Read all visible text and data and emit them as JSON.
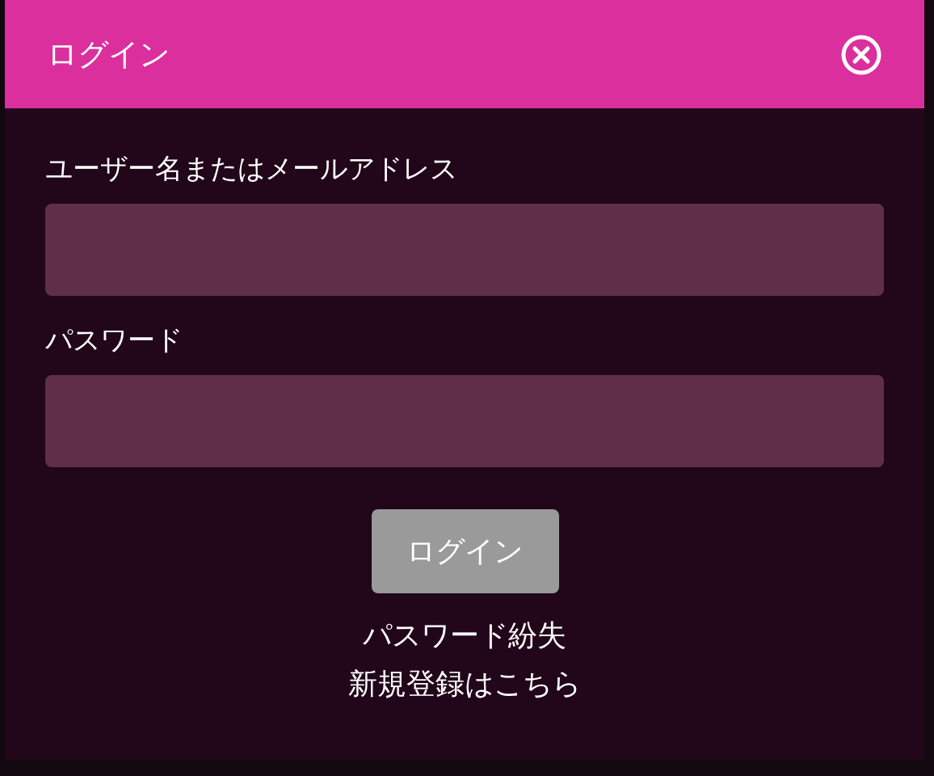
{
  "dialog": {
    "title": "ログイン"
  },
  "fields": [
    {
      "label": "ユーザー名またはメールアドレス"
    },
    {
      "label": "パスワード"
    }
  ],
  "submit": "ログイン",
  "links": [
    "パスワード紛失",
    "新規登録はこちら"
  ]
}
